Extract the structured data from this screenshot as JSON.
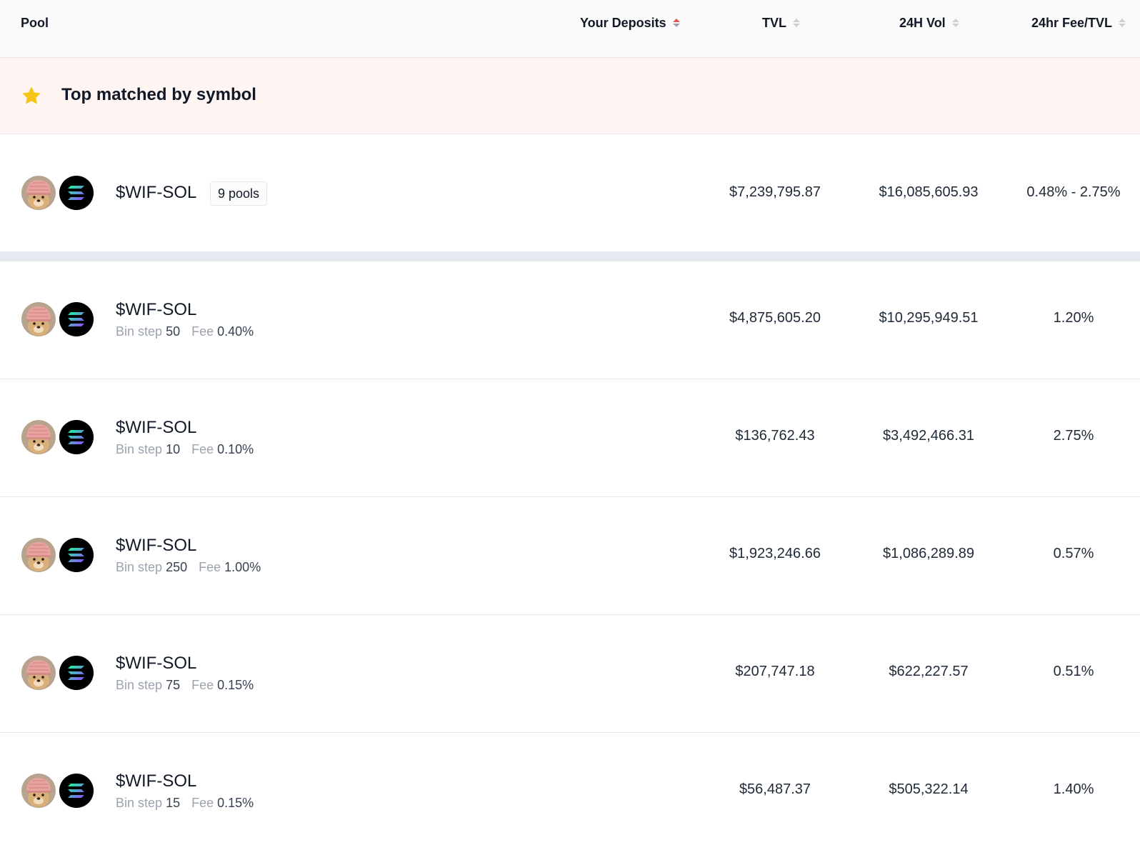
{
  "header": {
    "pool_label": "Pool",
    "deposits_label": "Your Deposits",
    "tvl_label": "TVL",
    "vol_label": "24H Vol",
    "fee_tvl_label": "24hr Fee/TVL"
  },
  "banner": {
    "icon": "star-icon",
    "text": "Top matched by symbol"
  },
  "group": {
    "name": "$WIF-SOL",
    "badge": "9 pools",
    "tvl": "$7,239,795.87",
    "vol": "$16,085,605.93",
    "fee_tvl": "0.48% - 2.75%"
  },
  "labels": {
    "bin_step": "Bin step",
    "fee": "Fee"
  },
  "pools": [
    {
      "name": "$WIF-SOL",
      "bin_step": "50",
      "fee": "0.40%",
      "tvl": "$4,875,605.20",
      "vol": "$10,295,949.51",
      "fee_tvl": "1.20%"
    },
    {
      "name": "$WIF-SOL",
      "bin_step": "10",
      "fee": "0.10%",
      "tvl": "$136,762.43",
      "vol": "$3,492,466.31",
      "fee_tvl": "2.75%"
    },
    {
      "name": "$WIF-SOL",
      "bin_step": "250",
      "fee": "1.00%",
      "tvl": "$1,923,246.66",
      "vol": "$1,086,289.89",
      "fee_tvl": "0.57%"
    },
    {
      "name": "$WIF-SOL",
      "bin_step": "75",
      "fee": "0.15%",
      "tvl": "$207,747.18",
      "vol": "$622,227.57",
      "fee_tvl": "0.51%"
    },
    {
      "name": "$WIF-SOL",
      "bin_step": "15",
      "fee": "0.15%",
      "tvl": "$56,487.37",
      "vol": "$505,322.14",
      "fee_tvl": "1.40%"
    }
  ],
  "colors": {
    "banner_bg": "#fff5f3",
    "separator": "#e6e9ef",
    "sort_active": "#e2574c",
    "star": "#f5c518"
  }
}
